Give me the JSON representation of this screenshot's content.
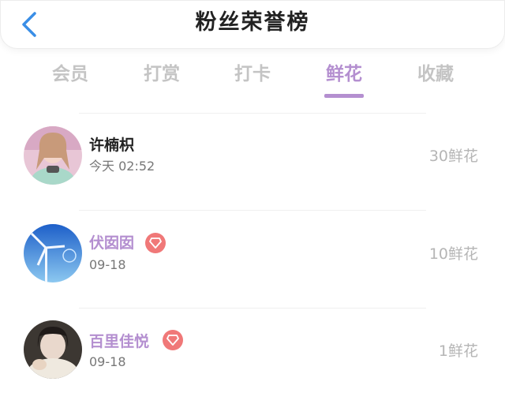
{
  "header": {
    "title": "粉丝荣誉榜"
  },
  "tabs": [
    {
      "label": "会员"
    },
    {
      "label": "打赏"
    },
    {
      "label": "打卡"
    },
    {
      "label": "鲜花"
    },
    {
      "label": "收藏"
    }
  ],
  "active_tab_index": 3,
  "entries": [
    {
      "name": "许楠枳",
      "time": "今天 02:52",
      "amount": "30鲜花",
      "name_color": "#222222",
      "has_badge": false
    },
    {
      "name": "伏囡囡",
      "time": "09-18",
      "amount": "10鲜花",
      "name_color": "#b48fd0",
      "has_badge": true
    },
    {
      "name": "百里佳悦",
      "time": "09-18",
      "amount": "1鲜花",
      "name_color": "#b48fd0",
      "has_badge": true
    }
  ],
  "colors": {
    "accent": "#b48fd0",
    "back_icon": "#3a8ee6",
    "badge": "#f07878",
    "muted": "#c4c4c4"
  },
  "icons": {
    "back": "chevron-left-icon",
    "badge": "diamond-icon"
  }
}
